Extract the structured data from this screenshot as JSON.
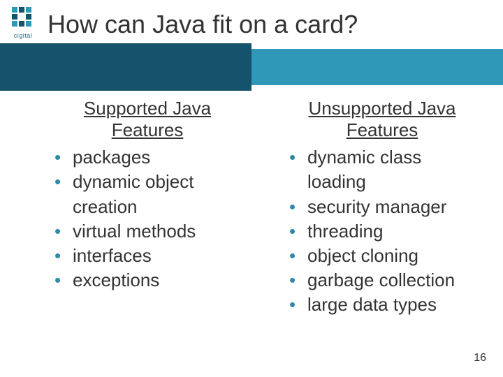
{
  "logo": {
    "text": "cigital"
  },
  "title": "How can Java fit on a card?",
  "left": {
    "heading": "Supported Java Features",
    "items": [
      "packages",
      "dynamic object creation",
      "virtual methods",
      "interfaces",
      "exceptions"
    ]
  },
  "right": {
    "heading": "Unsupported Java Features",
    "items": [
      "dynamic class loading",
      "security manager",
      "threading",
      "object cloning",
      "garbage collection",
      "large data types"
    ]
  },
  "page_number": "16"
}
